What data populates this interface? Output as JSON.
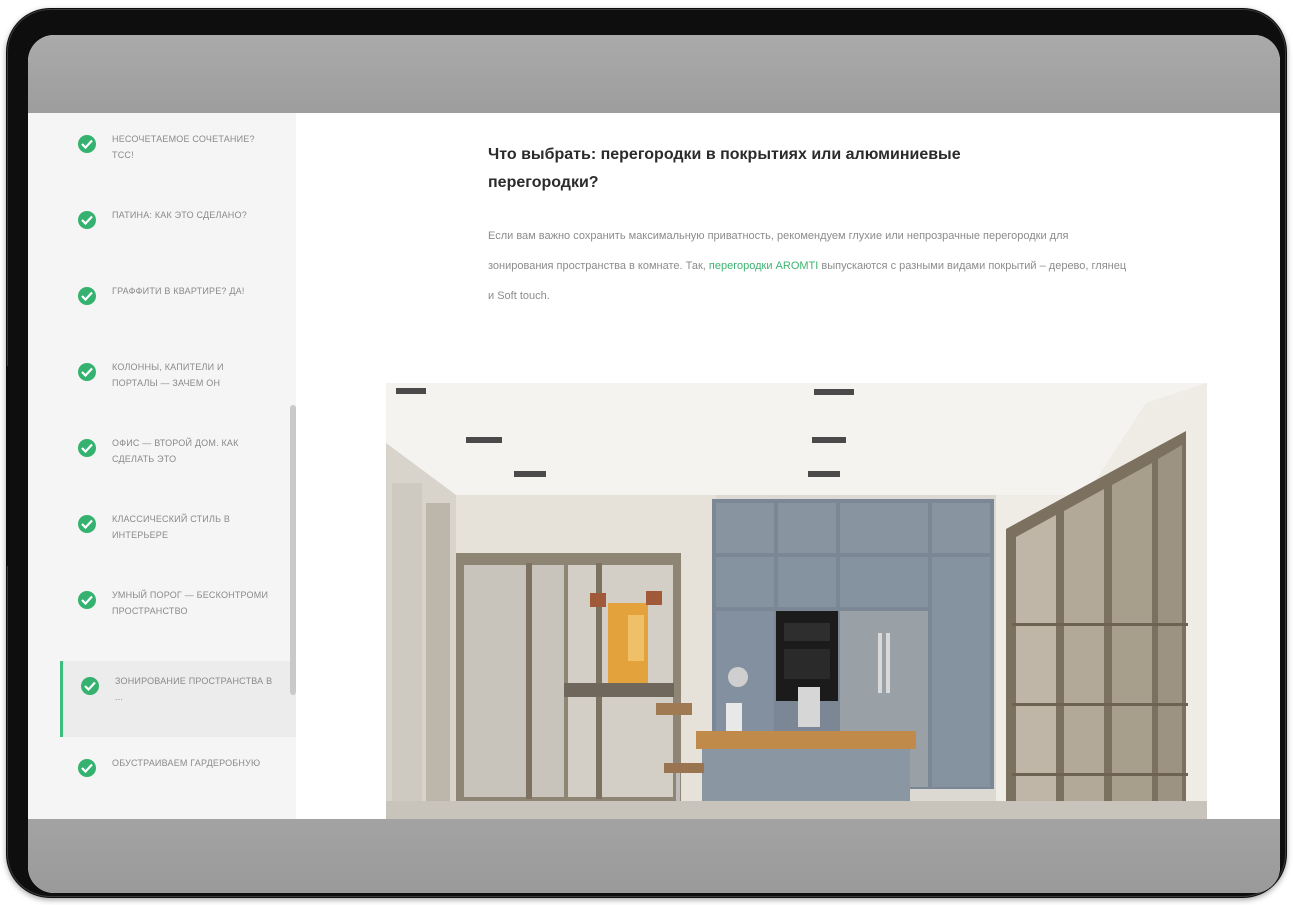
{
  "sidebar": {
    "items": [
      {
        "label": "Несочетаемое сочетание? Тсс!",
        "active": false
      },
      {
        "label": "Патина: как это сделано?",
        "active": false
      },
      {
        "label": "Граффити в квартире? Да!",
        "active": false
      },
      {
        "label": "Колонны, капители и порталы — зачем он",
        "active": false
      },
      {
        "label": "Офис — второй дом. Как сделать это",
        "active": false
      },
      {
        "label": "Классический стиль в интерьере",
        "active": false
      },
      {
        "label": "Умный порог — бесконтроми пространство",
        "active": false
      },
      {
        "label": "Зонирование пространства в ...",
        "active": true
      },
      {
        "label": "Обустраиваем гардеробную",
        "active": false
      }
    ]
  },
  "article": {
    "heading": "Что выбрать: перегородки в покрытиях или алюминиевые перегородки?",
    "para_before_link": "Если вам важно сохранить максимальную приватность, рекомендуем глухие или непрозрачные перегородки для зонирования пространства в комнате. Так, ",
    "para_link": "перегородки AROMTI",
    "para_after_link": " выпускаются с разными видами покрытий – дерево, глянец и Soft touch."
  },
  "colors": {
    "accent": "#35b26f",
    "device_frame": "#0e0e0e",
    "overlay_bar": "#a3a3a3"
  },
  "icons": {
    "sidebar_item": "check-circle-icon"
  }
}
